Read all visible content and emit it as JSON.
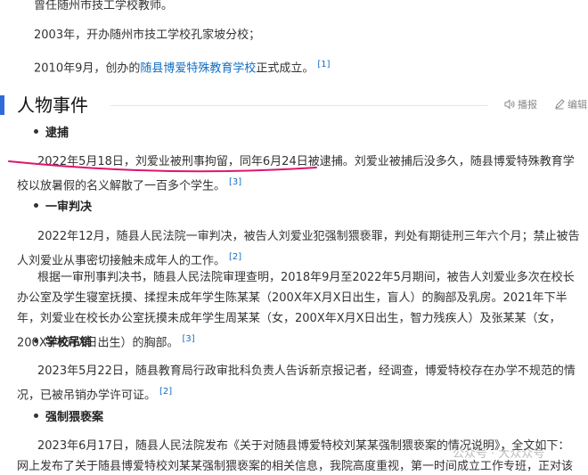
{
  "intro": {
    "line1": "曾任随州市技工学校教师。",
    "line2": "2003年，开办随州市技工学校孔家坡分校；",
    "line3_prefix": "2010年9月，创办的",
    "line3_link": "随县博爱特殊教育学校",
    "line3_suffix": "正式成立。",
    "line3_ref": "[1]"
  },
  "section": {
    "title": "人物事件",
    "broadcast_label": "播报",
    "edit_label": "编辑"
  },
  "events": [
    {
      "heading": "逮捕",
      "paragraphs": [
        {
          "text": "2022年5月18日，刘爱业被刑事拘留，同年6月24日被逮捕。刘爱业被捕后没多久，随县博爱特殊教育学校以放暑假的名义解散了一百多个学生。",
          "ref": "[3]"
        }
      ]
    },
    {
      "heading": "一审判决",
      "paragraphs": [
        {
          "text": "2022年12月，随县人民法院一审判决，被告人刘爱业犯强制猥亵罪，判处有期徒刑三年六个月；禁止被告人刘爱业从事密切接触未成年人的工作。",
          "ref": "[2]"
        },
        {
          "text": "根据一审刑事判决书，随县人民法院审理查明，2018年9月至2022年5月期间，被告人刘爱业多次在校长办公室及学生寝室抚摸、揉捏未成年学生陈某某（200X年X月X日出生，盲人）的胸部及乳房。2021年下半年，刘爱业在校长办公室抚摸未成年学生周某某（女，200X年X月X日出生，智力残疾人）及张某某（女，200X年X月X日出生）的胸部。",
          "ref": "[3]"
        }
      ]
    },
    {
      "heading": "学校吊销",
      "paragraphs": [
        {
          "text": "2023年5月22日，随县教育局行政审批科负责人告诉新京报记者，经调查，博爱特校存在办学不规范的情况，已被吊销办学许可证。",
          "ref": "[2]"
        }
      ]
    },
    {
      "heading": "强制猥亵案",
      "paragraphs": [
        {
          "text": "2023年6月17日，随县人民法院发布《关于对随县博爱特校刘某某强制猥亵案的情况说明》，全文如下：网上发布了关于随县博爱特校刘某某强制猥亵案的相关信息，我院高度重视，第一时间成立工作专班，正对该案件进行全案审查，最新情况将及时",
          "ref": ""
        }
      ]
    }
  ],
  "watermark": "公众号 · 大众众号",
  "colors": {
    "accent": "#2f6bd8",
    "link": "#136ec2",
    "annotation": "#e0146e"
  }
}
